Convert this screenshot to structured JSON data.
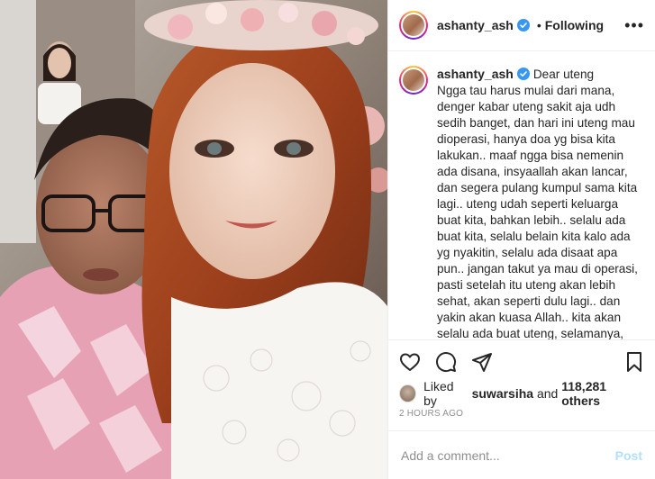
{
  "post": {
    "author": {
      "username": "ashanty_ash",
      "verified": true,
      "follow_status": "Following"
    },
    "header": {
      "more_icon": "more-horizontal-icon"
    },
    "caption": {
      "username": "ashanty_ash",
      "first_words": "Dear uteng",
      "text": "Ngga tau harus mulai dari mana, denger kabar uteng sakit aja udh sedih banget, dan hari ini uteng mau dioperasi, hanya doa yg bisa kita lakukan.. maaf ngga bisa nemenin ada disana, insyaallah akan lancar, dan segera pulang kumpul sama kita lagi.. uteng udah seperti keluarga buat kita, bahkan lebih.. selalu ada buat kita, selalu belain kita kalo ada yg nyakitin, selalu ada disaat apa pun.. jangan takut ya mau di operasi, pasti setelah itu uteng akan lebih sehat, akan seperti dulu lagi.. dan yakin akan kuasa Allah.. kita akan selalu ada buat uteng, selamanya, sampai maut yg memisahkan kita.. lancar yaa operasinya, jangan lupa doa dan harus kuat, jangan stres jadi pikiran!!"
    },
    "actions": {
      "like_icon": "heart-icon",
      "comment_icon": "comment-icon",
      "share_icon": "send-icon",
      "save_icon": "bookmark-icon"
    },
    "likes": {
      "prefix": "Liked by",
      "first_liker": "suwarsiha",
      "conjunction": "and",
      "others_count": "118,281 others"
    },
    "timestamp": "2 HOURS AGO",
    "comment_box": {
      "placeholder": "Add a comment...",
      "post_label": "Post"
    },
    "colors": {
      "verified_blue": "#3897f0",
      "post_button_disabled": "#b2dffc",
      "secondary_text": "#8e8e8e",
      "border": "#efefef"
    }
  }
}
